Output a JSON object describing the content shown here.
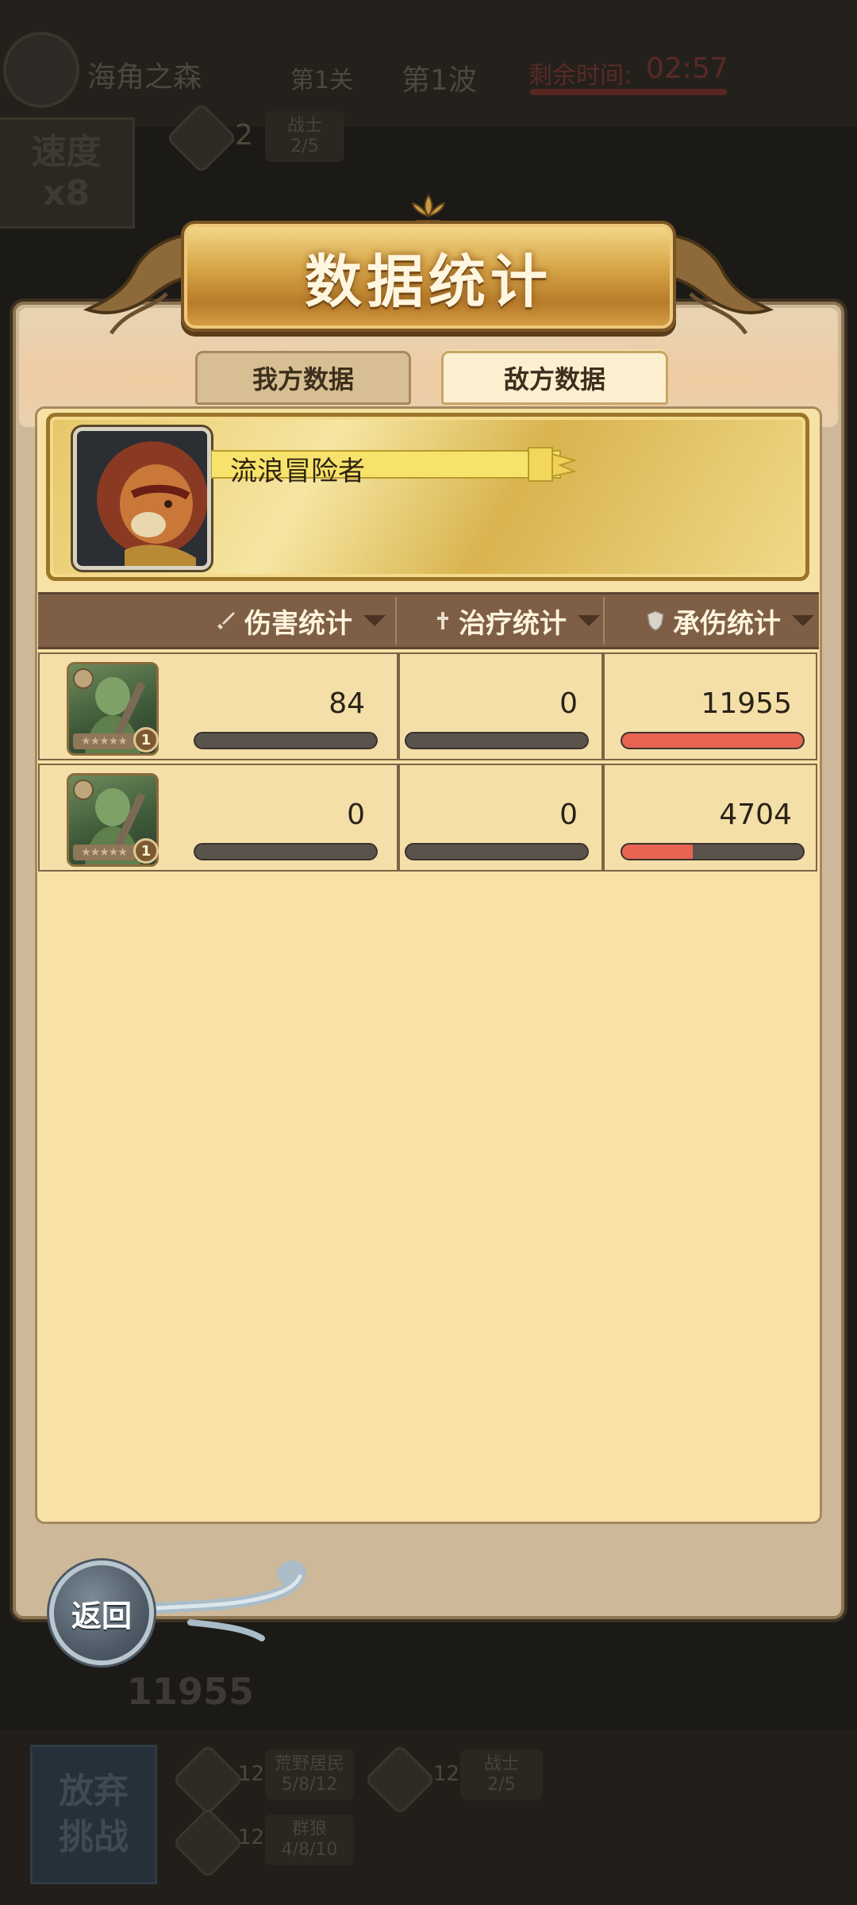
{
  "background_hud": {
    "stage_name": "海角之森",
    "level": "第1关",
    "wave": "第1波",
    "time_remaining_label": "剩余时间:",
    "time_remaining": "02:57",
    "speed_label": "速度",
    "speed_value": "x8",
    "top_unit_count": "2",
    "top_unit_type": "战士",
    "top_unit_ratio": "2/5",
    "damage_total": "11955",
    "give_up_line1": "放弃",
    "give_up_line2": "挑战",
    "bottom_units": [
      {
        "count": "12",
        "name": "荒野居民",
        "ratio": "5/8/12"
      },
      {
        "count": "12",
        "name": "战士",
        "ratio": "2/5"
      },
      {
        "count": "12",
        "name": "群狼",
        "ratio": "4/8/10"
      }
    ]
  },
  "popup": {
    "title": "数据统计",
    "tabs": [
      {
        "label": "我方数据",
        "active": false
      },
      {
        "label": "敌方数据",
        "active": true
      }
    ],
    "hero_name": "流浪冒险者",
    "columns": [
      {
        "label": "伤害统计",
        "icon": "sword-icon"
      },
      {
        "label": "治疗统计",
        "icon": "cross-icon"
      },
      {
        "label": "承伤统计",
        "icon": "shield-icon"
      }
    ],
    "rows": [
      {
        "unit_level": "1",
        "stars_text": "★★★★★",
        "damage": "84",
        "damage_fill": 0,
        "healing": "0",
        "healing_fill": 0,
        "damage_taken": "11955",
        "damage_taken_fill": 1.0
      },
      {
        "unit_level": "1",
        "stars_text": "★★★★★",
        "damage": "0",
        "damage_fill": 0,
        "healing": "0",
        "healing_fill": 0,
        "damage_taken": "4704",
        "damage_taken_fill": 0.39
      }
    ],
    "back_label": "返回"
  },
  "colors": {
    "bar_fill": "#e86452",
    "header_bg": "#7e5f45",
    "panel_bg": "#f7e1a5"
  }
}
